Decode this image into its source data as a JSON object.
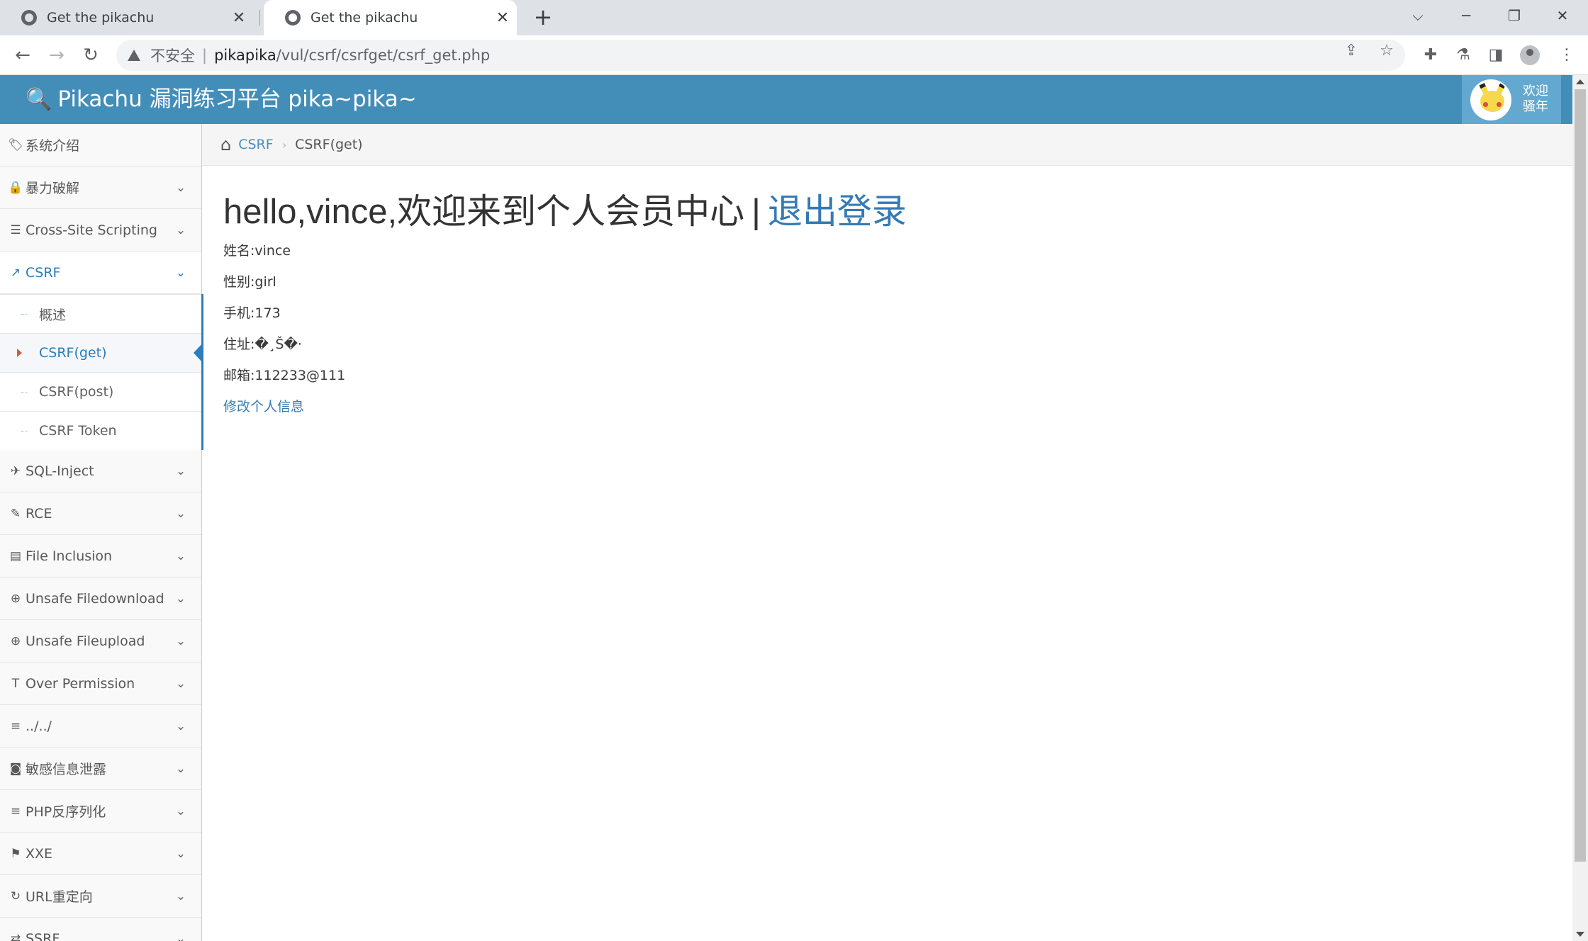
{
  "browser": {
    "tabs": [
      {
        "title": "Get the pikachu",
        "close": "✕"
      },
      {
        "title": "Get the pikachu",
        "close": "✕"
      }
    ],
    "new_tab": "+",
    "window_controls": {
      "tab_search": "⌵",
      "minimize": "─",
      "restore": "❐",
      "close": "✕"
    },
    "nav": {
      "back": "←",
      "forward": "→",
      "reload": "↻"
    },
    "address": {
      "security_label": "不安全",
      "separator": "|",
      "host": "pikapika",
      "path": "/vul/csrf/csrfget/csrf_get.php"
    },
    "icons": {
      "share": "share-icon",
      "star": "star-icon",
      "extensions": "puzzle-icon",
      "labs": "flask-icon",
      "side_panel": "side-panel-icon",
      "profile": "profile-icon",
      "menu": "kebab-menu-icon"
    }
  },
  "app": {
    "brand": "Pikachu 漏洞练习平台 pika~pika~",
    "user": {
      "welcome": "欢迎骚年"
    }
  },
  "sidebar": {
    "items": [
      {
        "icon": "🏷",
        "label": "系统介绍",
        "has_children": false
      },
      {
        "icon": "🔒",
        "label": "暴力破解",
        "has_children": true
      },
      {
        "icon": "☰",
        "label": "Cross-Site Scripting",
        "has_children": true
      },
      {
        "icon": "↗",
        "label": "CSRF",
        "has_children": true,
        "active": true
      },
      {
        "icon": "✈",
        "label": "SQL-Inject",
        "has_children": true
      },
      {
        "icon": "✎",
        "label": "RCE",
        "has_children": true
      },
      {
        "icon": "▤",
        "label": "File Inclusion",
        "has_children": true
      },
      {
        "icon": "⊕",
        "label": "Unsafe Filedownload",
        "has_children": true
      },
      {
        "icon": "⊕",
        "label": "Unsafe Fileupload",
        "has_children": true
      },
      {
        "icon": "T",
        "label": "Over Permission",
        "has_children": true
      },
      {
        "icon": "≡",
        "label": "../../",
        "has_children": true
      },
      {
        "icon": "◙",
        "label": "敏感信息泄露",
        "has_children": true
      },
      {
        "icon": "≡",
        "label": "PHP反序列化",
        "has_children": true
      },
      {
        "icon": "⚑",
        "label": "XXE",
        "has_children": true
      },
      {
        "icon": "↻",
        "label": "URL重定向",
        "has_children": true
      },
      {
        "icon": "⇄",
        "label": "SSRF",
        "has_children": true
      }
    ],
    "csrf_children": [
      {
        "label": "概述"
      },
      {
        "label": "CSRF(get)",
        "active": true
      },
      {
        "label": "CSRF(post)"
      },
      {
        "label": "CSRF Token"
      }
    ],
    "chevron": "⌄"
  },
  "breadcrumb": {
    "parent": "CSRF",
    "divider": "›",
    "current": "CSRF(get)"
  },
  "main": {
    "greeting": "hello,vince,欢迎来到个人会员中心",
    "pipe": "|",
    "logout": "退出登录",
    "fields": [
      {
        "text": "姓名:vince"
      },
      {
        "text": "性别:girl"
      },
      {
        "text": "手机:173"
      },
      {
        "text": "住址:�¸Š�·"
      },
      {
        "text": "邮箱:112233@111"
      }
    ],
    "edit_link": "修改个人信息"
  },
  "colors": {
    "navbar": "#438eb9",
    "accent": "#2b7dbc",
    "link": "#337ab7",
    "userbox": "#62a8d1"
  }
}
